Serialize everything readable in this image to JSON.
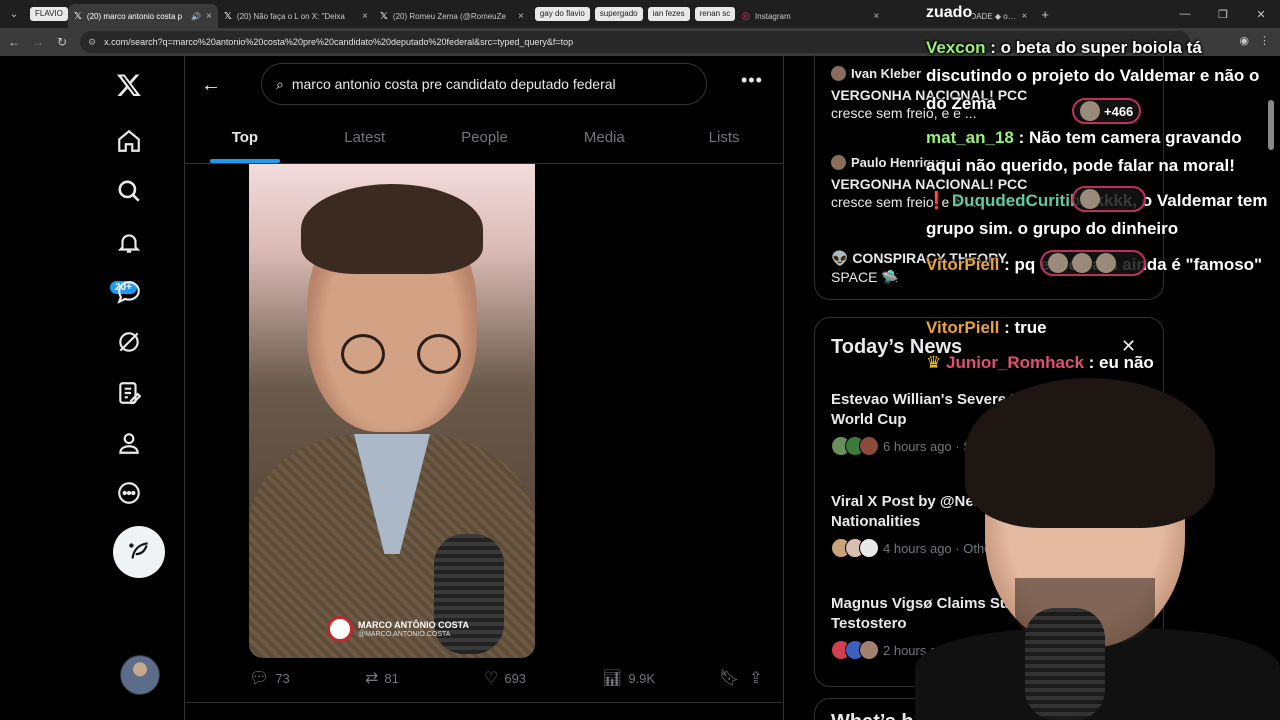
{
  "browser": {
    "tab_chips_left": [
      "FLAVIO"
    ],
    "tabs": [
      {
        "title": "(20) marco antonio costa p",
        "active": true,
        "icon": "x-logo-icon"
      },
      {
        "title": "(20) Não faça o L on X: \"Deixa",
        "active": false,
        "icon": "x-logo-icon"
      },
      {
        "title": "(20) Romeu Zema (@RomeuZe",
        "active": false,
        "icon": "x-logo-icon"
      }
    ],
    "tab_chips_right": [
      "gay do flavio",
      "supergado",
      "ian fezes",
      "renan sc"
    ],
    "instagram_tab": "Instagram",
    "last_tab": "LIBERDADE ◆ on X:",
    "url": "x.com/search?q=marco%20antonio%20costa%20pre%20candidato%20deputado%20federal&src=typed_query&f=top"
  },
  "nav": {
    "notifications_badge": "20+"
  },
  "search": {
    "query": "marco antonio costa pre candidato deputado federal"
  },
  "tabs": [
    "Top",
    "Latest",
    "People",
    "Media",
    "Lists"
  ],
  "post": {
    "watermark_name": "MARCO ANTÔNIO COSTA",
    "watermark_handle": "@MARCO.ANTONIO.COSTA",
    "replies": "73",
    "reposts": "81",
    "likes": "693",
    "views": "9.9K"
  },
  "trends": [
    {
      "author": "Ivan Kleber",
      "title": "VERGONHA NACIONAL! PCC",
      "sub": "cresce sem freio, e é ..."
    },
    {
      "author": "Paulo Henrique",
      "title": "VERGONHA NACIONAL! PCC",
      "sub": "cresce sem freio, e é ..."
    },
    {
      "title": "👽 CONSPIRACY THEORY",
      "sub": "SPACE 🛸"
    }
  ],
  "news": {
    "heading": "Today’s News",
    "items": [
      {
        "title": "Estevao Willian's Severe Ha… Jeopardizes World Cup",
        "meta": "6 hours ago · Sp"
      },
      {
        "title": "Viral X Post by @Nebaz… Asks What Nationalities",
        "meta": "4 hours ago · Other"
      },
      {
        "title": "Magnus Vigsø Claims Surr… Increases Testostero",
        "meta": "2 hours ag"
      }
    ],
    "next_heading": "What’s h"
  },
  "overlay": {
    "channel": "zuado",
    "pill_count": "+466",
    "messages": [
      {
        "user": "Vexcon",
        "color": "#9bf07a",
        "text": "o beta do super boiola tá discutindo o projeto do Valdemar e não o do Zema"
      },
      {
        "user": "mat_an_18",
        "color": "#9bf07a",
        "text": "Não tem camera gravando aqui não querido, pode falar na moral!"
      },
      {
        "user": "DuqudedCuritiba",
        "color": "#62c8a8",
        "text": "kkkk, o Valdemar tem grupo sim. o grupo do dinheiro"
      },
      {
        "user": "VitorPiell",
        "color": "#e8a33d",
        "text": "pq esse cara ainda é \"famoso\""
      },
      {
        "user": "VitorPiell",
        "color": "#e8a33d",
        "text": "true"
      },
      {
        "user": "Junior_Romhack",
        "color": "#e05070",
        "text": "eu não"
      }
    ]
  },
  "colors": {
    "accent": "#1d9bf0",
    "background": "#000000",
    "text": "#e7e9ea",
    "muted": "#71767b",
    "border": "#2f3336"
  }
}
